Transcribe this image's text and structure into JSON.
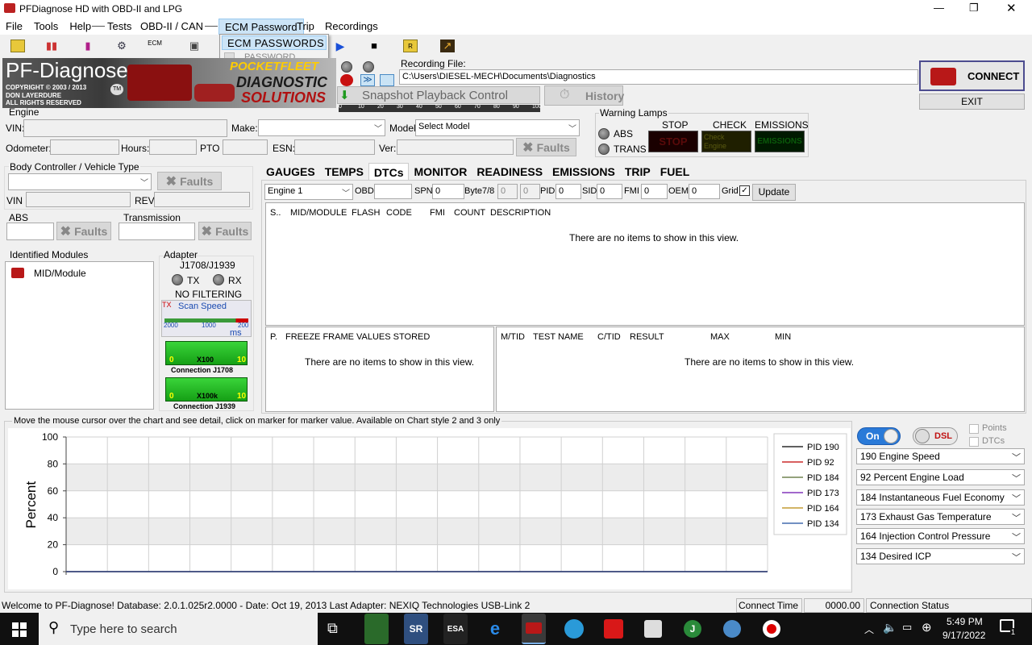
{
  "window": {
    "title": "PFDiagnose HD with OBD-II and LPG",
    "minimize": "—",
    "restore": "❐",
    "close": "✕"
  },
  "menu": {
    "items": [
      "File",
      "Tools",
      "Help",
      "Tests",
      "OBD-II / CAN",
      "ECM Password",
      "Trip",
      "Recordings"
    ],
    "dropdown": {
      "item1": "ECM PASSWORDS",
      "item2": "PASSWORD"
    }
  },
  "toolbar": {
    "ecm_label": "ECM"
  },
  "banner": {
    "title": "PF-Diagnose",
    "tm": "TM",
    "copyright1": "COPYRIGHT © 2003 / 2013",
    "copyright2": "DON LAYERDURE",
    "copyright3": "ALL RIGHTS RESERVED",
    "brand1": "POCKETFLEET",
    "brand2": "DIAGNOSTIC",
    "brand3": "SOLUTIONS"
  },
  "scale": {
    "ticks": [
      "0",
      "10",
      "20",
      "30",
      "40",
      "50",
      "60",
      "70",
      "80",
      "90",
      "100"
    ]
  },
  "recording": {
    "label": "Recording File:",
    "path": "C:\\Users\\DIESEL-MECH\\Documents\\Diagnostics"
  },
  "snapshot": {
    "label": "Snapshot Playback Control"
  },
  "history": {
    "label": "History"
  },
  "connect": {
    "label": "CONNECT",
    "exit": "EXIT"
  },
  "engine": {
    "group": "Engine",
    "vin_label": "VIN:",
    "make_label": "Make:",
    "model_label": "Model",
    "model_value": "Select Model",
    "odometer_label": "Odometer:",
    "hours_label": "Hours:",
    "pto_label": "PTO",
    "esn_label": "ESN:",
    "ver_label": "Ver:",
    "faults": "Faults"
  },
  "warning": {
    "group": "Warning Lamps",
    "abs": "ABS",
    "trans": "TRANS",
    "stop": "STOP",
    "check": "CHECK",
    "emissions": "EMISSIONS",
    "stop_img": "STOP",
    "check_img1": "Check",
    "check_img2": "Engine",
    "emissions_img": "EMISSIONS"
  },
  "body": {
    "group": "Body Controller / Vehicle Type",
    "faults": "Faults",
    "vin_label": "VIN",
    "rev_label": "REV"
  },
  "abs": {
    "group": "ABS",
    "faults": "Faults"
  },
  "transmission": {
    "group": "Transmission",
    "faults": "Faults"
  },
  "modules": {
    "group": "Identified Modules",
    "item": "MID/Module"
  },
  "adapter": {
    "group": "Adapter",
    "protocol": "J1708/J1939",
    "tx": "TX",
    "rx": "RX",
    "filtering": "NO FILTERING",
    "scan_tx": "TX",
    "scan_label": "Scan Speed",
    "scan_2000": "2000",
    "scan_1000": "1000",
    "scan_200": "200",
    "scan_ms": "ms",
    "conn1_0": "0",
    "conn1_x": "X100",
    "conn1_10": "10",
    "conn1_label": "Connection J1708",
    "conn2_0": "0",
    "conn2_x": "X100k",
    "conn2_10": "10",
    "conn2_label": "Connection J1939"
  },
  "tabs": [
    "GAUGES",
    "TEMPS",
    "DTCs",
    "MONITOR",
    "READINESS",
    "EMISSIONS",
    "TRIP",
    "FUEL"
  ],
  "dtc_bar": {
    "engine": "Engine 1",
    "obd_label": "OBD",
    "spn_label": "SPN",
    "spn_value": "0",
    "byte78": "Byte7/8",
    "b7": "0",
    "b8": "0",
    "pid_label": "PID",
    "pid_value": "0",
    "sid_label": "SID",
    "sid_value": "0",
    "fmi_label": "FMI",
    "fmi_value": "0",
    "oem_label": "OEM",
    "oem_value": "0",
    "grid_label": "Grid",
    "grid_check": "✓",
    "update": "Update"
  },
  "dtc_table": {
    "columns": [
      "S..",
      "MID/MODULE",
      "FLASH",
      "CODE",
      "FMI",
      "COUNT",
      "DESCRIPTION"
    ],
    "empty": "There are no items to show in this view."
  },
  "freeze_table": {
    "columns": [
      "P.",
      "FREEZE FRAME VALUES STORED"
    ],
    "empty": "There are no items to show in this view."
  },
  "test_table": {
    "columns": [
      "M/TID",
      "TEST NAME",
      "C/TID",
      "RESULT",
      "MAX",
      "MIN"
    ],
    "empty": "There are no items to show in this view."
  },
  "chart_hint": "Move the mouse cursor over the chart and see detail, click on marker for marker value. Available on Chart style 2 and 3 only",
  "chart_data": {
    "type": "line",
    "ylabel": "Percent",
    "ylim": [
      0,
      100
    ],
    "yticks": [
      "100",
      "80",
      "60",
      "40",
      "20",
      "0"
    ],
    "series": [
      {
        "name": "PID 190",
        "color": "#000000",
        "values": [
          0
        ]
      },
      {
        "name": "PID 92",
        "color": "#c00000",
        "values": [
          0
        ]
      },
      {
        "name": "PID 184",
        "color": "#556b2f",
        "values": [
          0
        ]
      },
      {
        "name": "PID 173",
        "color": "#6a0dad",
        "values": [
          0
        ]
      },
      {
        "name": "PID 164",
        "color": "#b8860b",
        "values": [
          0
        ]
      },
      {
        "name": "PID 134",
        "color": "#1f4e9e",
        "values": [
          0
        ]
      }
    ]
  },
  "toggles": {
    "on": "On",
    "dsl": "DSL",
    "points": "Points",
    "dtcs": "DTCs"
  },
  "selects": [
    "190 Engine Speed",
    "92 Percent Engine Load",
    "184 Instantaneous Fuel Economy",
    "173 Exhaust Gas Temperature",
    "164 Injection Control Pressure",
    "134 Desired ICP"
  ],
  "status": {
    "message": "Welcome to PF-Diagnose! Database: 2.0.1.025r2.0000 - Date: Oct 19, 2013 Last Adapter: NEXIQ Technologies USB-Link 2",
    "connect_time_label": "Connect Time",
    "connect_time": "0000.00",
    "connection_status": "Connection Status"
  },
  "taskbar": {
    "search": "Type here to search",
    "time": "5:49 PM",
    "date": "9/17/2022",
    "apps": [
      "SR",
      "ESA",
      "e",
      "J"
    ],
    "notify": "1"
  }
}
